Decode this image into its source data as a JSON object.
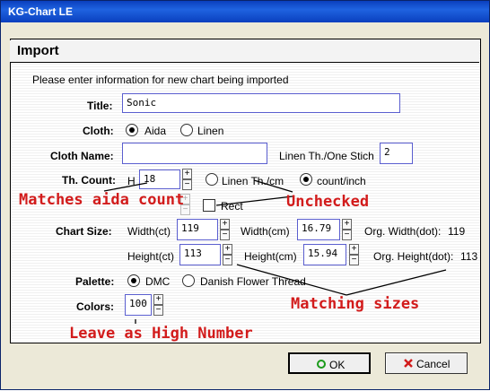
{
  "window": {
    "title": "KG-Chart LE"
  },
  "dialog": {
    "header": "Import",
    "instruction": "Please enter information for new chart being imported",
    "title_label": "Title:",
    "title_value": "Sonic",
    "cloth_label": "Cloth:",
    "cloth_options": [
      "Aida",
      "Linen"
    ],
    "cloth_selected": "Aida",
    "cloth_name_label": "Cloth Name:",
    "cloth_name_value": "",
    "linen_stitch_label": "Linen Th./One Stich",
    "linen_stitch_value": "2",
    "thread_count_label": "Th. Count:",
    "thread_count_prefix": "H",
    "thread_count_value": "18",
    "count_unit_options": [
      "Linen Th./cm",
      "count/inch"
    ],
    "count_unit_selected": "count/inch",
    "rect_label": "Rect",
    "rect_checked": false,
    "chart_size_label": "Chart Size:",
    "width_ct_label": "Width(ct)",
    "width_ct_value": "119",
    "width_cm_label": "Width(cm)",
    "width_cm_value": "16.79",
    "org_width_label": "Org. Width(dot):",
    "org_width_value": "119",
    "height_ct_label": "Height(ct)",
    "height_ct_value": "113",
    "height_cm_label": "Height(cm)",
    "height_cm_value": "15.94",
    "org_height_label": "Org. Height(dot):",
    "org_height_value": "113",
    "palette_label": "Palette:",
    "palette_options": [
      "DMC",
      "Danish Flower Thread"
    ],
    "palette_selected": "DMC",
    "colors_label": "Colors:",
    "colors_value": "100"
  },
  "annotations": {
    "matches_aida": "Matches aida count",
    "unchecked": "Unchecked",
    "matching_sizes": "Matching sizes",
    "leave_high": "Leave as High Number"
  },
  "buttons": {
    "ok": "OK",
    "cancel": "Cancel"
  },
  "colors": {
    "title_bar": "#0a3fbe",
    "annotation": "#d21b1b",
    "ok_icon": "#1a9a1a",
    "cancel_icon": "#d21b1b"
  }
}
